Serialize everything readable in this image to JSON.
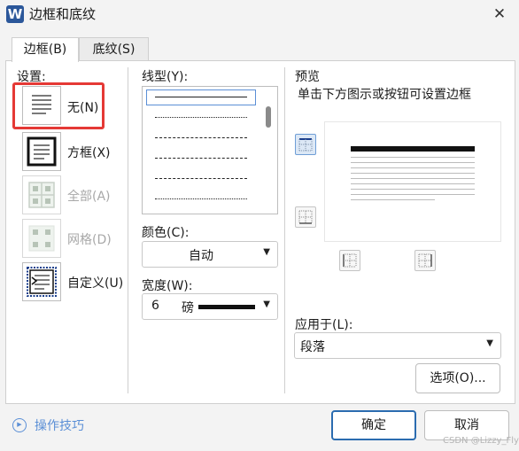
{
  "window": {
    "app_icon_letter": "W",
    "title": "边框和底纹",
    "close_glyph": "✕"
  },
  "tabs": [
    {
      "label": "边框(B)",
      "active": true
    },
    {
      "label": "底纹(S)",
      "active": false
    }
  ],
  "settings": {
    "label": "设置:",
    "items": [
      {
        "label": "无(N)",
        "enabled": true,
        "selected": true
      },
      {
        "label": "方框(X)",
        "enabled": true,
        "selected": false
      },
      {
        "label": "全部(A)",
        "enabled": false,
        "selected": false
      },
      {
        "label": "网格(D)",
        "enabled": false,
        "selected": false
      },
      {
        "label": "自定义(U)",
        "enabled": true,
        "selected": false
      }
    ]
  },
  "line_style": {
    "label": "线型(Y):",
    "styles": [
      "solid",
      "dotted",
      "dashed",
      "dash-long",
      "dash-dot",
      "dash-dot-dot"
    ]
  },
  "color": {
    "label": "颜色(C):",
    "value": "自动"
  },
  "width": {
    "label": "宽度(W):",
    "value": "6",
    "unit": "磅"
  },
  "preview": {
    "title": "预览",
    "hint": "单击下方图示或按钮可设置边框"
  },
  "apply_to": {
    "label": "应用于(L):",
    "value": "段落"
  },
  "options_button": "选项(O)...",
  "tips_label": "操作技巧",
  "ok_button": "确定",
  "cancel_button": "取消",
  "watermark": "CSDN @Lizzy_Fly",
  "colors": {
    "accent": "#2b6cb0",
    "highlight": "#e53935",
    "link": "#5b8fd6"
  }
}
